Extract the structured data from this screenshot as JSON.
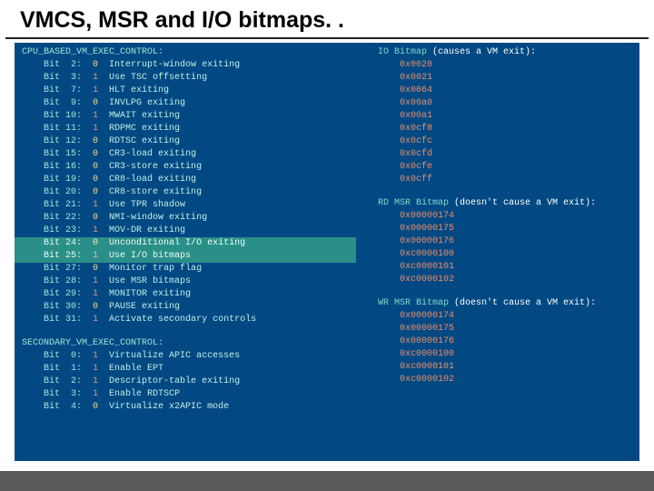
{
  "title": "VMCS, MSR and I/O bitmaps. .",
  "left": {
    "section1": "CPU_BASED_VM_EXEC_CONTROL:",
    "section2": "SECONDARY_VM_EXEC_CONTROL:",
    "bits1": [
      {
        "bit": "2",
        "val": "0",
        "desc": "Interrupt-window exiting"
      },
      {
        "bit": "3",
        "val": "1",
        "desc": "Use TSC offsetting"
      },
      {
        "bit": "7",
        "val": "1",
        "desc": "HLT exiting"
      },
      {
        "bit": "9",
        "val": "0",
        "desc": "INVLPG exiting"
      },
      {
        "bit": "10",
        "val": "1",
        "desc": "MWAIT exiting"
      },
      {
        "bit": "11",
        "val": "1",
        "desc": "RDPMC exiting"
      },
      {
        "bit": "12",
        "val": "0",
        "desc": "RDTSC exiting"
      },
      {
        "bit": "15",
        "val": "0",
        "desc": "CR3-load exiting"
      },
      {
        "bit": "16",
        "val": "0",
        "desc": "CR3-store exiting"
      },
      {
        "bit": "19",
        "val": "0",
        "desc": "CR8-load exiting"
      },
      {
        "bit": "20",
        "val": "0",
        "desc": "CR8-store exiting"
      },
      {
        "bit": "21",
        "val": "1",
        "desc": "Use TPR shadow"
      },
      {
        "bit": "22",
        "val": "0",
        "desc": "NMI-window exiting"
      },
      {
        "bit": "23",
        "val": "1",
        "desc": "MOV-DR exiting"
      }
    ],
    "bits1_hl": [
      {
        "bit": "24",
        "val": "0",
        "desc": "Unconditional I/O exiting"
      },
      {
        "bit": "25",
        "val": "1",
        "desc": "Use I/O bitmaps"
      }
    ],
    "bits1_after": [
      {
        "bit": "27",
        "val": "0",
        "desc": "Monitor trap flag"
      },
      {
        "bit": "28",
        "val": "1",
        "desc": "Use MSR bitmaps"
      },
      {
        "bit": "29",
        "val": "1",
        "desc": "MONITOR exiting"
      },
      {
        "bit": "30",
        "val": "0",
        "desc": "PAUSE exiting"
      },
      {
        "bit": "31",
        "val": "1",
        "desc": "Activate secondary controls"
      }
    ],
    "bits2": [
      {
        "bit": "0",
        "val": "1",
        "desc": "Virtualize APIC accesses"
      },
      {
        "bit": "1",
        "val": "1",
        "desc": "Enable EPT"
      },
      {
        "bit": "2",
        "val": "1",
        "desc": "Descriptor-table exiting"
      },
      {
        "bit": "3",
        "val": "1",
        "desc": "Enable RDTSCP"
      },
      {
        "bit": "4",
        "val": "0",
        "desc": "Virtualize x2APIC mode"
      }
    ]
  },
  "right": {
    "io": {
      "label_a": "IO Bitmap",
      "label_b": " (causes a VM exit):",
      "values": [
        "0x0020",
        "0x0021",
        "0x0064",
        "0x00a0",
        "0x00a1",
        "0x0cf8",
        "0x0cfc",
        "0x0cfd",
        "0x0cfe",
        "0x0cff"
      ]
    },
    "rd": {
      "label_a": "RD MSR Bitmap",
      "label_b": " (doesn't cause a VM exit):",
      "values": [
        "0x00000174",
        "0x00000175",
        "0x00000176",
        "0xc0000100",
        "0xc0000101",
        "0xc0000102"
      ]
    },
    "wr": {
      "label_a": "WR MSR Bitmap",
      "label_b": " (doesn't cause a VM exit):",
      "values": [
        "0x00000174",
        "0x00000175",
        "0x00000176",
        "0xc0000100",
        "0xc0000101",
        "0xc0000102"
      ]
    }
  }
}
